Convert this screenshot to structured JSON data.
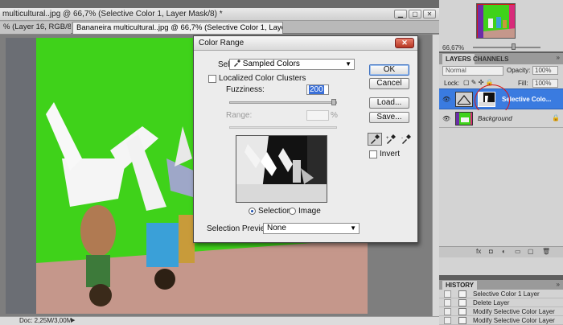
{
  "document": {
    "title": "multicultural..jpg @ 66,7% (Selective Color 1, Layer Mask/8) *",
    "tabs": [
      {
        "label": "% (Layer 16, RGB/8) *"
      },
      {
        "label": "Bananeira multicultural..jpg @ 66,7% (Selective Color 1, Layer Mask/8) *"
      }
    ],
    "status": "Doc: 2,25M/3,00M",
    "status_arrow": "▶"
  },
  "dialog": {
    "title": "Color Range",
    "close_glyph": "✕",
    "select_label": "Select:",
    "select_value": "Sampled Colors",
    "localized_label": "Localized Color Clusters",
    "fuzziness_label": "Fuzziness:",
    "fuzziness_value": "200",
    "range_label": "Range:",
    "range_unit": "%",
    "radio_selection": "Selection",
    "radio_image": "Image",
    "preview_label": "Selection Preview:",
    "preview_value": "None",
    "buttons": {
      "ok": "OK",
      "cancel": "Cancel",
      "load": "Load...",
      "save": "Save..."
    },
    "invert_label": "Invert"
  },
  "navigator": {
    "zoom": "66,67%"
  },
  "layers": {
    "tab_layers": "LAYERS",
    "tab_channels": "CHANNELS",
    "menu_glyph": "»",
    "blend_mode": "Normal",
    "opacity_label": "Opacity:",
    "opacity_value": "100%",
    "lock_label": "Lock:",
    "fill_label": "Fill:",
    "fill_value": "100%",
    "items": [
      {
        "name": "Selective Colo..."
      },
      {
        "name": "Background"
      }
    ],
    "bottom_icons": [
      "fx",
      "◘",
      "◐",
      "▭",
      "▢",
      "🗑"
    ]
  },
  "history": {
    "tab": "HISTORY",
    "items": [
      {
        "label": "Selective Color 1 Layer"
      },
      {
        "label": "Delete Layer"
      },
      {
        "label": "Modify Selective Color Layer"
      },
      {
        "label": "Modify Selective Color Layer"
      }
    ]
  },
  "colors": {
    "accent": "#3a7be0",
    "green_wall": "#3fd21a",
    "close_red": "#c0432d"
  }
}
